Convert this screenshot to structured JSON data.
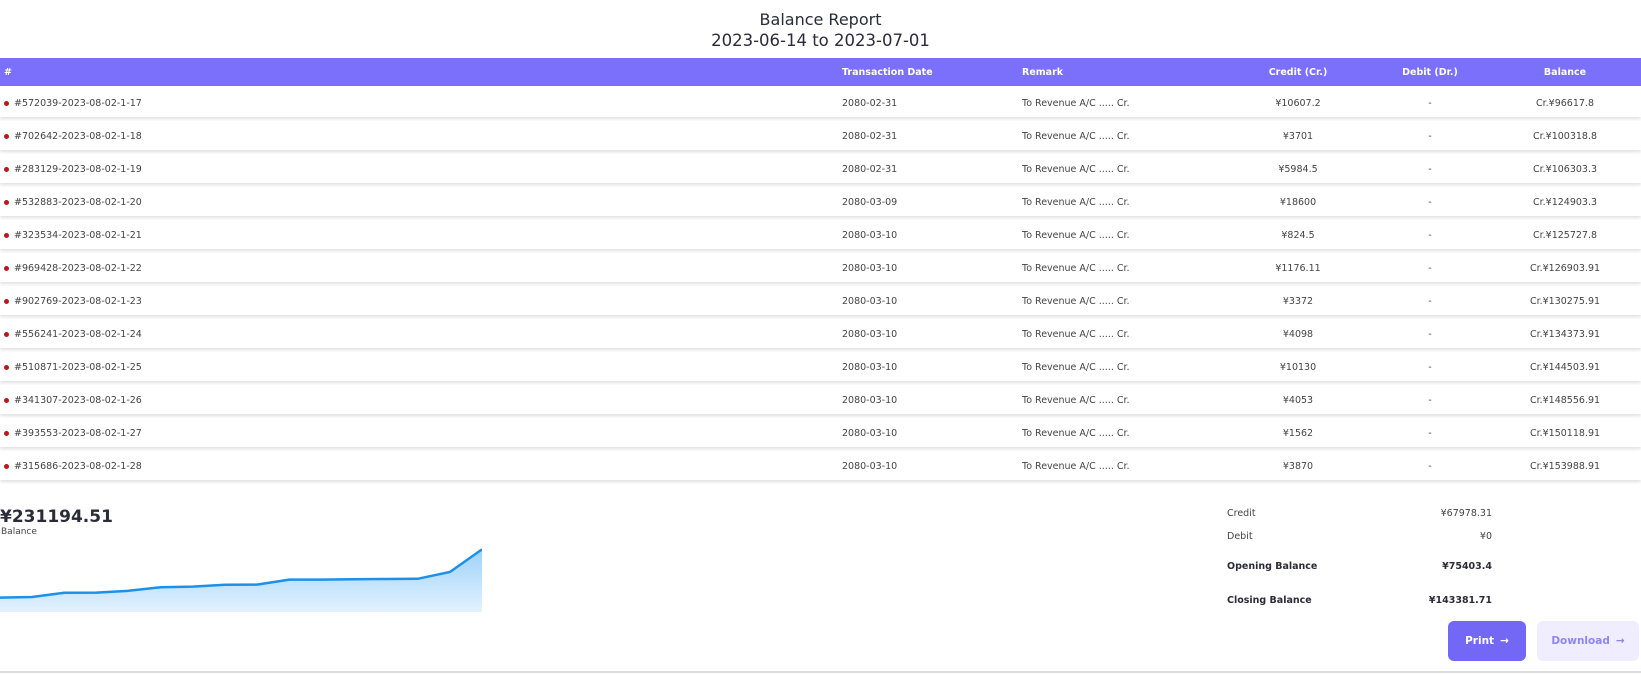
{
  "report": {
    "title": "Balance Report",
    "date_range": "2023-06-14 to 2023-07-01"
  },
  "table": {
    "headers": {
      "id": "#",
      "date": "Transaction Date",
      "remark": "Remark",
      "credit": "Credit (Cr.)",
      "debit": "Debit (Dr.)",
      "balance": "Balance"
    },
    "rows": [
      {
        "id": "#572039-2023-08-02-1-17",
        "date": "2080-02-31",
        "remark": "To Revenue A/C ..... Cr.",
        "credit": "¥10607.2",
        "debit": "-",
        "balance": "Cr.¥96617.8"
      },
      {
        "id": "#702642-2023-08-02-1-18",
        "date": "2080-02-31",
        "remark": "To Revenue A/C ..... Cr.",
        "credit": "¥3701",
        "debit": "-",
        "balance": "Cr.¥100318.8"
      },
      {
        "id": "#283129-2023-08-02-1-19",
        "date": "2080-02-31",
        "remark": "To Revenue A/C ..... Cr.",
        "credit": "¥5984.5",
        "debit": "-",
        "balance": "Cr.¥106303.3"
      },
      {
        "id": "#532883-2023-08-02-1-20",
        "date": "2080-03-09",
        "remark": "To Revenue A/C ..... Cr.",
        "credit": "¥18600",
        "debit": "-",
        "balance": "Cr.¥124903.3"
      },
      {
        "id": "#323534-2023-08-02-1-21",
        "date": "2080-03-10",
        "remark": "To Revenue A/C ..... Cr.",
        "credit": "¥824.5",
        "debit": "-",
        "balance": "Cr.¥125727.8"
      },
      {
        "id": "#969428-2023-08-02-1-22",
        "date": "2080-03-10",
        "remark": "To Revenue A/C ..... Cr.",
        "credit": "¥1176.11",
        "debit": "-",
        "balance": "Cr.¥126903.91"
      },
      {
        "id": "#902769-2023-08-02-1-23",
        "date": "2080-03-10",
        "remark": "To Revenue A/C ..... Cr.",
        "credit": "¥3372",
        "debit": "-",
        "balance": "Cr.¥130275.91"
      },
      {
        "id": "#556241-2023-08-02-1-24",
        "date": "2080-03-10",
        "remark": "To Revenue A/C ..... Cr.",
        "credit": "¥4098",
        "debit": "-",
        "balance": "Cr.¥134373.91"
      },
      {
        "id": "#510871-2023-08-02-1-25",
        "date": "2080-03-10",
        "remark": "To Revenue A/C ..... Cr.",
        "credit": "¥10130",
        "debit": "-",
        "balance": "Cr.¥144503.91"
      },
      {
        "id": "#341307-2023-08-02-1-26",
        "date": "2080-03-10",
        "remark": "To Revenue A/C ..... Cr.",
        "credit": "¥4053",
        "debit": "-",
        "balance": "Cr.¥148556.91"
      },
      {
        "id": "#393553-2023-08-02-1-27",
        "date": "2080-03-10",
        "remark": "To Revenue A/C ..... Cr.",
        "credit": "¥1562",
        "debit": "-",
        "balance": "Cr.¥150118.91"
      },
      {
        "id": "#315686-2023-08-02-1-28",
        "date": "2080-03-10",
        "remark": "To Revenue A/C ..... Cr.",
        "credit": "¥3870",
        "debit": "-",
        "balance": "Cr.¥153988.91"
      }
    ]
  },
  "balance_card": {
    "value": "¥231194.51",
    "label": "Balance"
  },
  "chart_data": {
    "type": "area",
    "series": [
      {
        "values": [
          0.2,
          0.5,
          2.6,
          2.7,
          3.6,
          5.4,
          5.7,
          6.6,
          6.7,
          9.2,
          9.2,
          9.4,
          9.5,
          9.6,
          13.0,
          24.3
        ]
      }
    ],
    "grid": false
  },
  "summary": {
    "credit_label": "Credit",
    "credit_value": "¥67978.31",
    "debit_label": "Debit",
    "debit_value": "¥0",
    "opening_label": "Opening Balance",
    "opening_value": "¥75403.4",
    "closing_label": "Closing Balance",
    "closing_value": "¥143381.71"
  },
  "actions": {
    "print_label": "Print",
    "download_label": "Download"
  },
  "colors": {
    "accent": "#7b70fb",
    "row_dot": "#c0151b",
    "chart_line": "#1e90e8",
    "chart_fill": "#bfe2fb"
  }
}
